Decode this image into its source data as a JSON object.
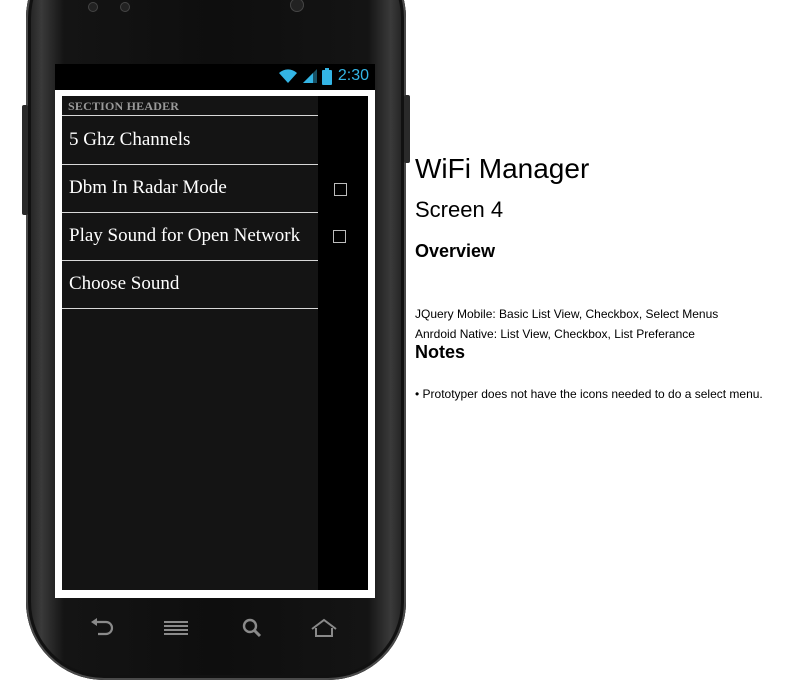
{
  "device": {
    "status_time": "2:30",
    "status_icons": [
      "wifi-icon",
      "signal-icon",
      "battery-icon"
    ],
    "nav_icons": [
      "back-icon",
      "menu-icon",
      "search-icon",
      "home-icon"
    ],
    "accent_color": "#33b5e5"
  },
  "app": {
    "section_header": "SECTION HEADER",
    "items": [
      {
        "label": "5 Ghz Channels",
        "has_checkbox": false,
        "checked": false
      },
      {
        "label": "Dbm In Radar Mode",
        "has_checkbox": true,
        "checked": false
      },
      {
        "label": "Play Sound for Open Network",
        "has_checkbox": true,
        "checked": false
      },
      {
        "label": "Choose Sound",
        "has_checkbox": false,
        "checked": false
      }
    ]
  },
  "doc": {
    "title": "WiFi Manager",
    "subtitle": "Screen 4",
    "overview_heading": "Overview",
    "overview_lines": [
      "JQuery Mobile: Basic List View, Checkbox, Select Menus",
      "Anrdoid Native: List View, Checkbox, List Preferance"
    ],
    "notes_heading": "Notes",
    "notes_lines": [
      "• Prototyper does not have the icons needed to do a select menu."
    ]
  }
}
